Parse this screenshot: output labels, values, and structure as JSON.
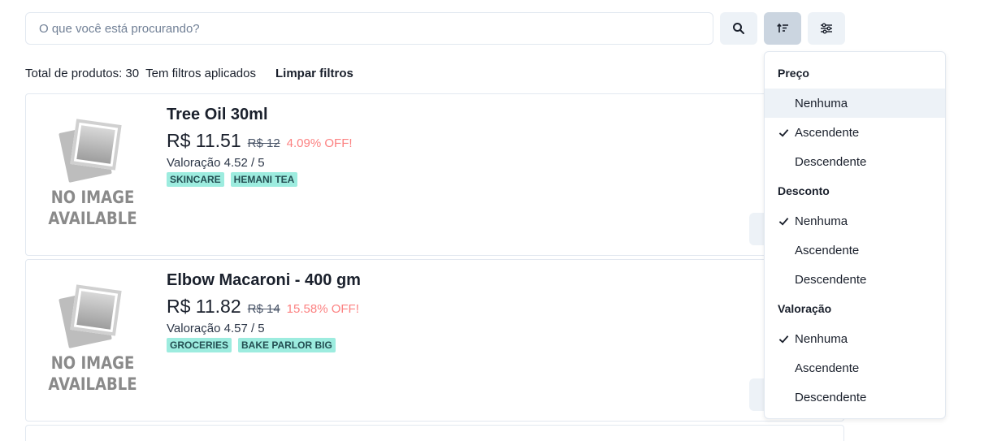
{
  "search": {
    "placeholder": "O que você está procurando?"
  },
  "toolbar": {
    "search_icon": "search-icon",
    "sort_icon": "sort-icon",
    "filter_icon": "sliders-icon"
  },
  "summary": {
    "total_label": "Total de produtos: 30",
    "filters_label": "Tem filtros aplicados",
    "clear_label": "Limpar filtros"
  },
  "image_placeholder": {
    "line1": "NO IMAGE",
    "line2": "AVAILABLE"
  },
  "products": [
    {
      "title": "Tree Oil 30ml",
      "price": "R$ 11.51",
      "old_price": "R$ 12",
      "discount": "4.09% OFF!",
      "rating": "Valoração 4.52 / 5",
      "tags": [
        "SKINCARE",
        "HEMANI TEA"
      ]
    },
    {
      "title": "Elbow Macaroni - 400 gm",
      "price": "R$ 11.82",
      "old_price": "R$ 14",
      "discount": "15.58% OFF!",
      "rating": "Valoração 4.57 / 5",
      "tags": [
        "GROCERIES",
        "BAKE PARLOR BIG"
      ]
    }
  ],
  "sort_menu": {
    "groups": [
      {
        "title": "Preço",
        "options": [
          "Nenhuma",
          "Ascendente",
          "Descendente"
        ],
        "selected": 1
      },
      {
        "title": "Desconto",
        "options": [
          "Nenhuma",
          "Ascendente",
          "Descendente"
        ],
        "selected": 0
      },
      {
        "title": "Valoração",
        "options": [
          "Nenhuma",
          "Ascendente",
          "Descendente"
        ],
        "selected": 0
      }
    ]
  },
  "colors": {
    "tag_bg": "#9decdf",
    "discount": "#fc8181",
    "active_button": "#cbd5e0"
  }
}
